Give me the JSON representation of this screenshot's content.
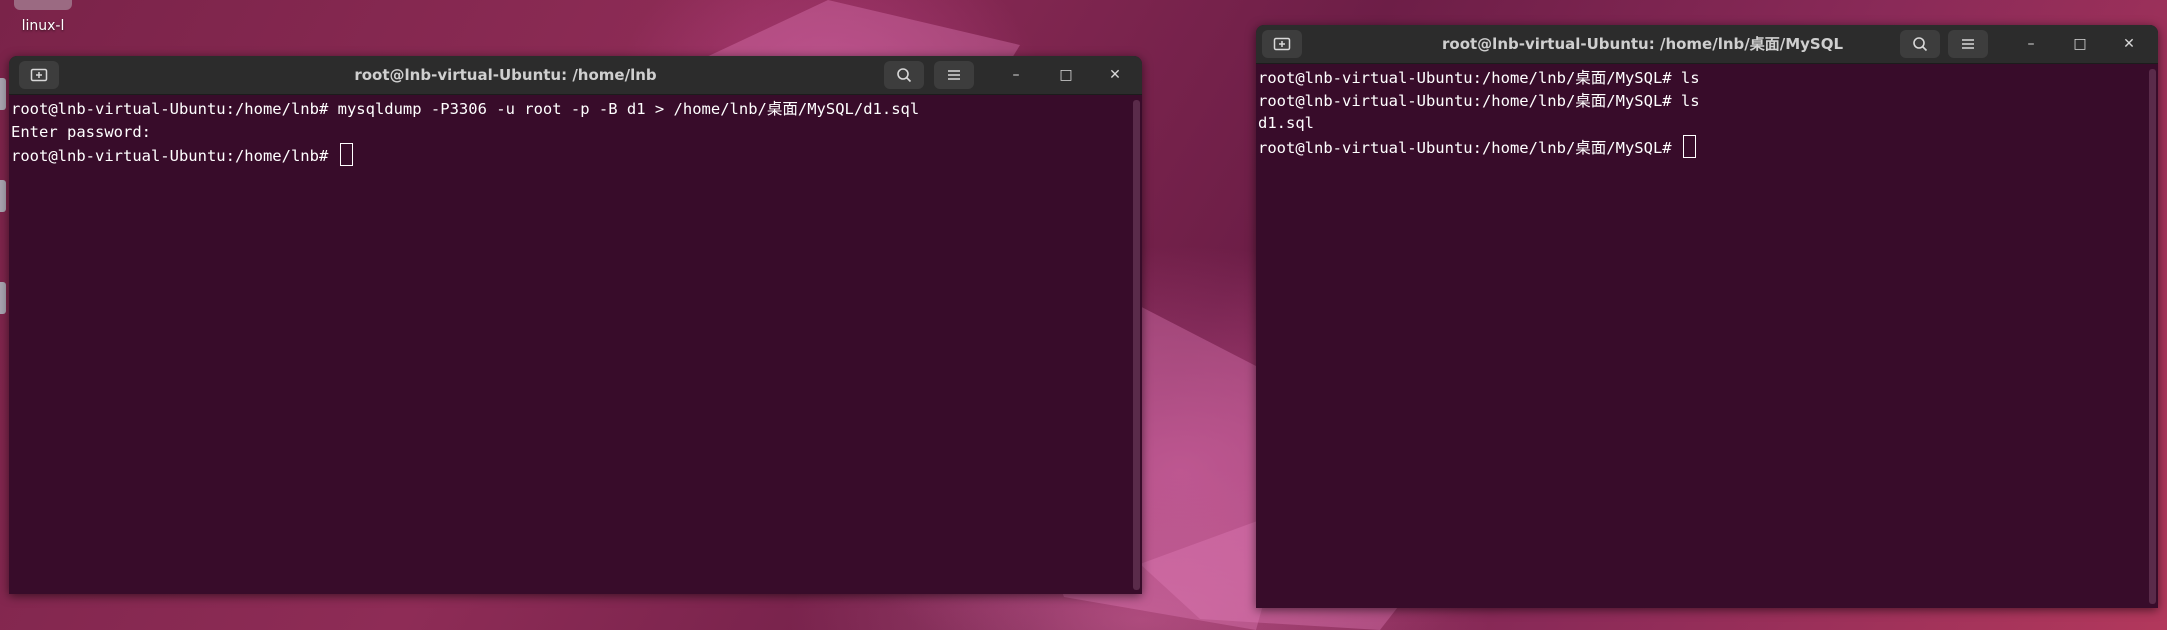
{
  "desktop": {
    "icon_label": "linux-l"
  },
  "left_terminal": {
    "title": "root@lnb-virtual-Ubuntu: /home/lnb",
    "lines": [
      "root@lnb-virtual-Ubuntu:/home/lnb# mysqldump -P3306 -u root -p -B d1 > /home/lnb/桌面/MySQL/d1.sql",
      "Enter password:",
      "root@lnb-virtual-Ubuntu:/home/lnb# "
    ]
  },
  "right_terminal": {
    "title": "root@lnb-virtual-Ubuntu: /home/lnb/桌面/MySQL",
    "lines": [
      "root@lnb-virtual-Ubuntu:/home/lnb/桌面/MySQL# ls",
      "root@lnb-virtual-Ubuntu:/home/lnb/桌面/MySQL# ls",
      "d1.sql",
      "root@lnb-virtual-Ubuntu:/home/lnb/桌面/MySQL# "
    ]
  },
  "window_controls": {
    "minimize": "–",
    "maximize": "□",
    "close": "✕"
  },
  "icons": [
    "new-tab-icon",
    "search-icon",
    "hamburger-menu-icon",
    "minimize-icon",
    "maximize-icon",
    "close-icon"
  ]
}
